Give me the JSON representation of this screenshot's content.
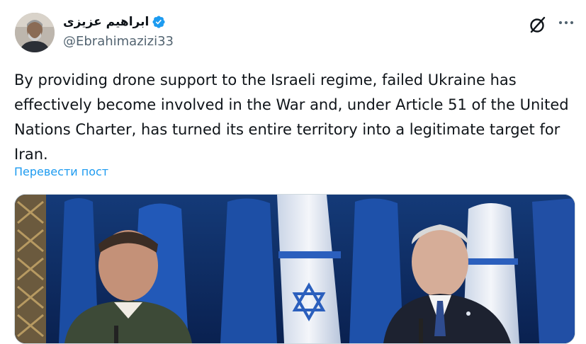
{
  "author": {
    "display_name": "ابراهیم عزیزی",
    "handle": "@Ebrahimazizi33",
    "verified": true,
    "verified_color": "#1d9bf0"
  },
  "actions": {
    "grok_icon": "grok-icon",
    "more_icon": "more-icon"
  },
  "tweet": {
    "text": "By providing drone support to the Israeli regime, failed Ukraine has effectively become involved in the War and, under Article 51 of the United Nations Charter, has turned its entire territory into a legitimate target for Iran.",
    "translate_label": "Перевести пост"
  },
  "media": {
    "kind": "photo",
    "description_icon": "press-photo"
  },
  "colors": {
    "text": "#0f1419",
    "secondary": "#536471",
    "link": "#1d9bf0"
  }
}
